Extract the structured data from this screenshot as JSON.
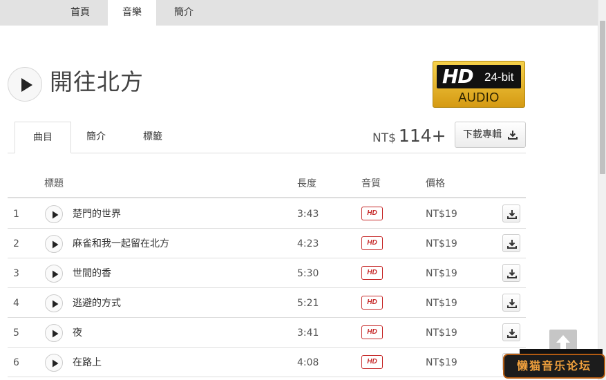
{
  "topnav": {
    "tabs": [
      {
        "label": "首頁",
        "active": false
      },
      {
        "label": "音樂",
        "active": true
      },
      {
        "label": "簡介",
        "active": false
      }
    ]
  },
  "album": {
    "title": "開往北方",
    "badge": {
      "hd": "HD",
      "bit": "24-bit",
      "audio": "AUDIO"
    }
  },
  "subtabs": [
    {
      "label": "曲目",
      "active": true
    },
    {
      "label": "簡介",
      "active": false
    },
    {
      "label": "標籤",
      "active": false
    }
  ],
  "price": {
    "currency": "NT$",
    "value": "114+"
  },
  "download_album_label": "下載專輯",
  "table": {
    "headers": {
      "title": "標題",
      "length": "長度",
      "quality": "音質",
      "price": "價格"
    },
    "rows": [
      {
        "num": "1",
        "title": "楚門的世界",
        "length": "3:43",
        "quality": "HD",
        "price": "NT$19"
      },
      {
        "num": "2",
        "title": "麻雀和我一起留在北方",
        "length": "4:23",
        "quality": "HD",
        "price": "NT$19"
      },
      {
        "num": "3",
        "title": "世間的香",
        "length": "5:30",
        "quality": "HD",
        "price": "NT$19"
      },
      {
        "num": "4",
        "title": "逃避的方式",
        "length": "5:21",
        "quality": "HD",
        "price": "NT$19"
      },
      {
        "num": "5",
        "title": "夜",
        "length": "3:41",
        "quality": "HD",
        "price": "NT$19"
      },
      {
        "num": "6",
        "title": "在路上",
        "length": "4:08",
        "quality": "HD",
        "price": "NT$19"
      }
    ]
  },
  "watermark": {
    "text": "懒猫音乐论坛"
  },
  "colors": {
    "hd_red": "#c62828",
    "badge_gold": "#e8b830",
    "nav_bg": "#e2e2e2"
  }
}
